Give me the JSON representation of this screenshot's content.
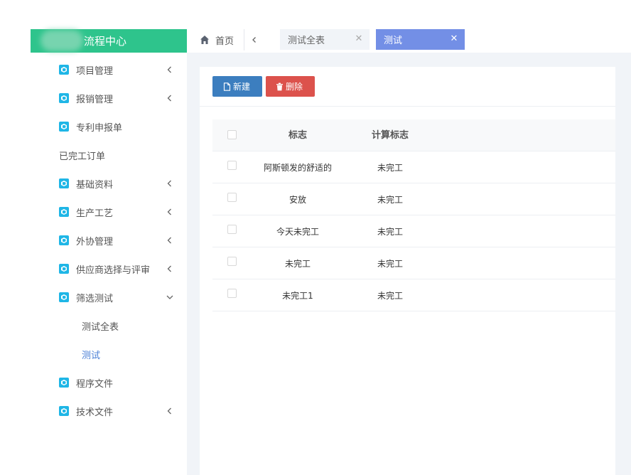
{
  "sidebar": {
    "title": "流程中心",
    "items": [
      {
        "label": "项目管理",
        "icon": "cube-icon",
        "has_icon": true,
        "arrow": "left"
      },
      {
        "label": "报销管理",
        "icon": "cube-icon",
        "has_icon": true,
        "arrow": "left"
      },
      {
        "label": "专利申报单",
        "icon": "cube-icon",
        "has_icon": true,
        "arrow": ""
      },
      {
        "label": "已完工订单",
        "icon": "",
        "has_icon": false,
        "arrow": ""
      },
      {
        "label": "基础资料",
        "icon": "cube-icon",
        "has_icon": true,
        "arrow": "left"
      },
      {
        "label": "生产工艺",
        "icon": "cube-icon",
        "has_icon": true,
        "arrow": "left"
      },
      {
        "label": "外协管理",
        "icon": "cube-icon",
        "has_icon": true,
        "arrow": "left"
      },
      {
        "label": "供应商选择与评审",
        "icon": "cube-icon",
        "has_icon": true,
        "arrow": "left"
      },
      {
        "label": "筛选测试",
        "icon": "cube-icon",
        "has_icon": true,
        "arrow": "down"
      },
      {
        "label": "测试全表",
        "sub": true,
        "active": false
      },
      {
        "label": "测试",
        "sub": true,
        "active": true
      },
      {
        "label": "程序文件",
        "icon": "cube-icon",
        "has_icon": true,
        "arrow": ""
      },
      {
        "label": "技术文件",
        "icon": "cube-icon",
        "has_icon": true,
        "arrow": "left"
      }
    ]
  },
  "tabs": {
    "home": "首页",
    "items": [
      {
        "label": "测试全表",
        "active": false
      },
      {
        "label": "测试",
        "active": true
      }
    ]
  },
  "toolbar": {
    "new_label": "新建",
    "delete_label": "删除"
  },
  "table": {
    "columns": [
      "标志",
      "计算标志"
    ],
    "rows": [
      [
        "阿斯顿发的舒适的",
        "未完工"
      ],
      [
        "安放",
        "未完工"
      ],
      [
        "今天未完工",
        "未完工"
      ],
      [
        "未完工",
        "未完工"
      ],
      [
        "未完工1",
        "未完工"
      ]
    ]
  },
  "colors": {
    "logo_bg": "#2ec48c",
    "active_tab": "#738fe6",
    "new_button": "#3c7ebf",
    "delete_button": "#dc524c",
    "menu_icon": "#1fb6e6",
    "active_sub": "#4a7fd6"
  }
}
